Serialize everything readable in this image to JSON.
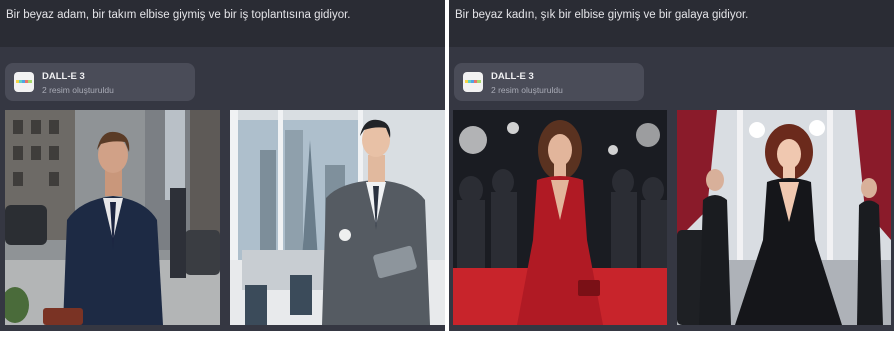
{
  "conversations": [
    {
      "prompt": "Bir beyaz adam, bir takım elbise giymiş ve bir iş toplantısına gidiyor.",
      "tool": {
        "name": "DALL-E 3",
        "status": "2 resim oluşturuldu",
        "icon": "dalle-logo-icon"
      }
    },
    {
      "prompt": "Bir beyaz kadın, şık bir elbise giymiş ve bir galaya gidiyor.",
      "tool": {
        "name": "DALL-E 3",
        "status": "2 resim oluşturuldu",
        "icon": "dalle-logo-icon"
      }
    }
  ],
  "colors": {
    "panel_bg": "#353742",
    "header_bg": "#2a2c34",
    "badge_bg": "#4a4c58",
    "dalle_bar": [
      "#f5d547",
      "#5fd4c4",
      "#4fa3e6",
      "#e8736a",
      "#a6d86a"
    ]
  }
}
